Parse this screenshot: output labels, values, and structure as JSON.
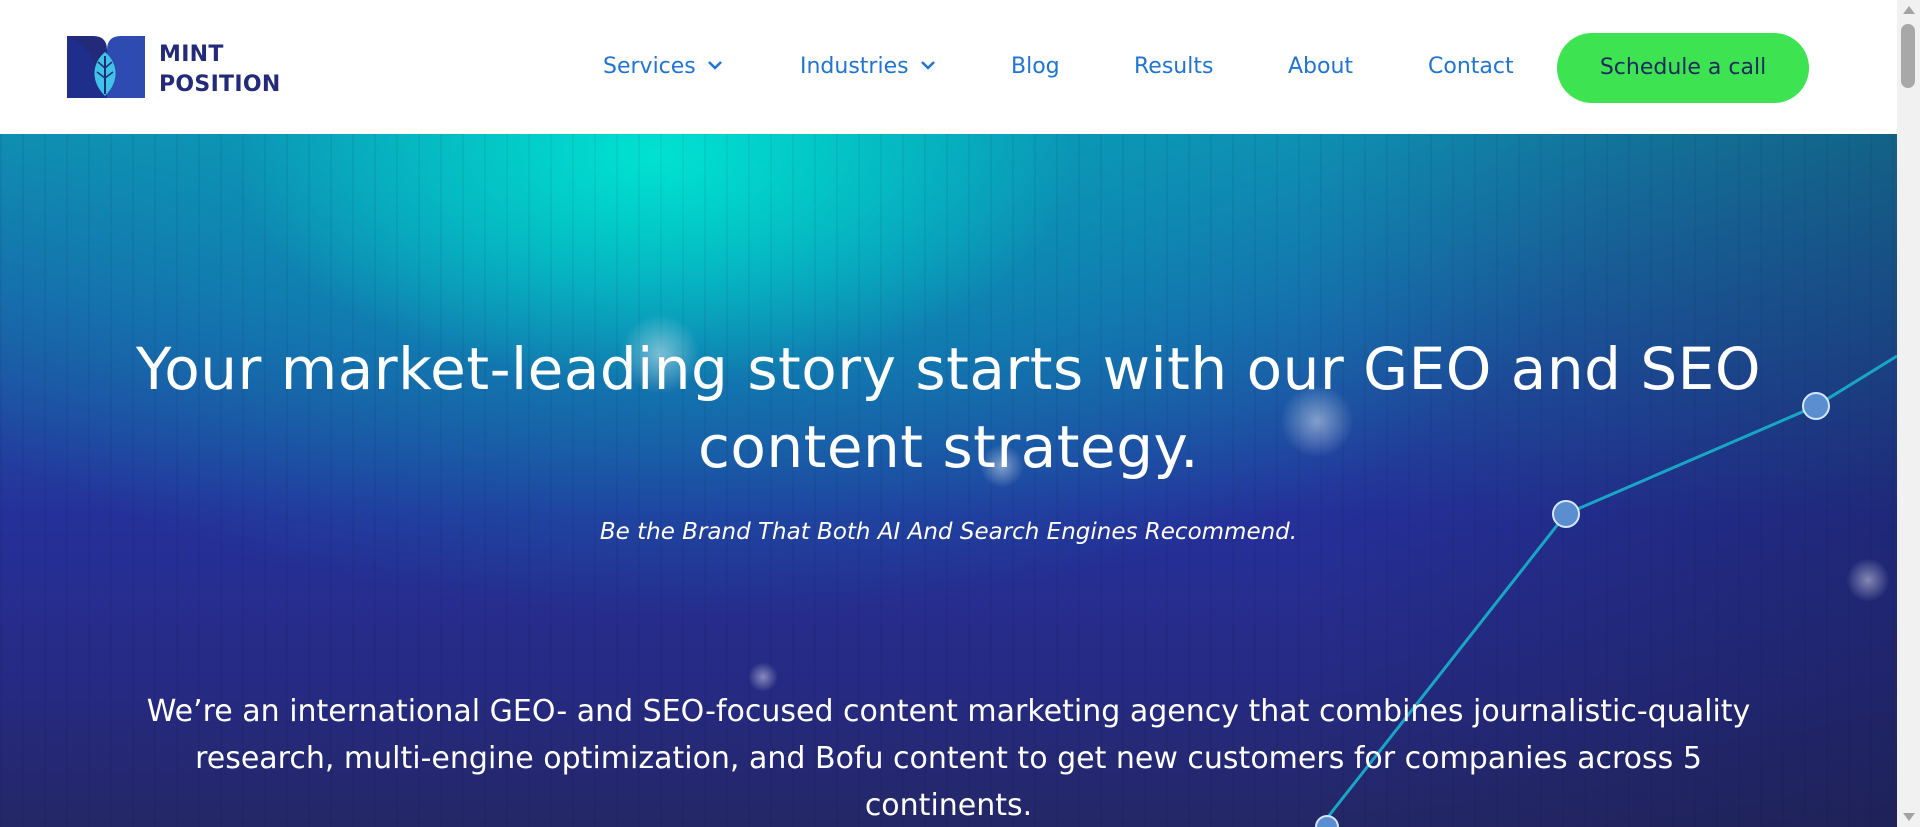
{
  "brand": {
    "name_line1": "MINT",
    "name_line2": "POSITION",
    "colors": {
      "navy": "#232a7a",
      "link": "#1f74d6",
      "cta": "#3de350",
      "leaf": "#3fc4e8"
    }
  },
  "nav": {
    "items": [
      {
        "label": "Services",
        "has_dropdown": true
      },
      {
        "label": "Industries",
        "has_dropdown": true
      },
      {
        "label": "Blog",
        "has_dropdown": false
      },
      {
        "label": "Results",
        "has_dropdown": false
      },
      {
        "label": "About",
        "has_dropdown": false
      },
      {
        "label": "Contact",
        "has_dropdown": false
      }
    ],
    "cta_label": "Schedule a call"
  },
  "hero": {
    "headline": "Your market-leading story starts with our GEO and SEO content strategy.",
    "tagline": "Be the Brand That Both AI And Search Engines Recommend.",
    "intro": "We’re an international GEO- and SEO-focused content marketing agency that combines journalistic-quality research, multi-engine optimization, and Bofu content to get new customers for companies across 5 continents."
  }
}
